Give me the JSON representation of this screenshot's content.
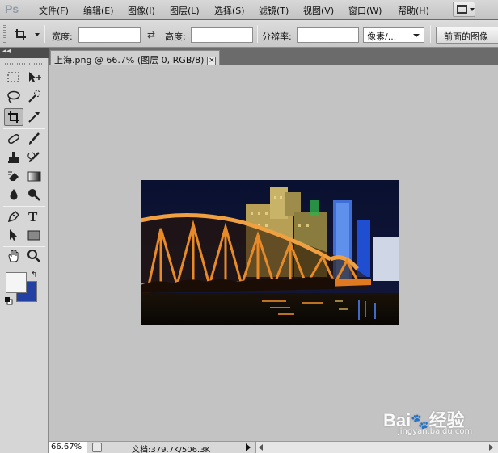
{
  "app": {
    "logo": "Ps"
  },
  "menu": {
    "items": [
      "文件(F)",
      "编辑(E)",
      "图像(I)",
      "图层(L)",
      "选择(S)",
      "滤镜(T)",
      "视图(V)",
      "窗口(W)",
      "帮助(H)"
    ]
  },
  "options": {
    "width_label": "宽度:",
    "width_value": "",
    "height_label": "高度:",
    "height_value": "",
    "resolution_label": "分辨率:",
    "resolution_value": "",
    "unit_select": "像素/...",
    "front_image_button": "前面的图像"
  },
  "tools_panel": {
    "collapse_glyph": "◂◂"
  },
  "document": {
    "tab_title": "上海.png @ 66.7% (图层 0, RGB/8)",
    "tab_close": "×",
    "image_alt": "Night photo of an illuminated steel truss bridge with city buildings behind"
  },
  "colors": {
    "foreground": "#f5f5f5",
    "background": "#2241a3"
  },
  "status": {
    "zoom": "66.67%",
    "doc_size": "文档:379.7K/506.3K"
  },
  "watermark": {
    "brand": "Bai",
    "brand2": "经验",
    "url": "jingyan.baidu.com"
  }
}
